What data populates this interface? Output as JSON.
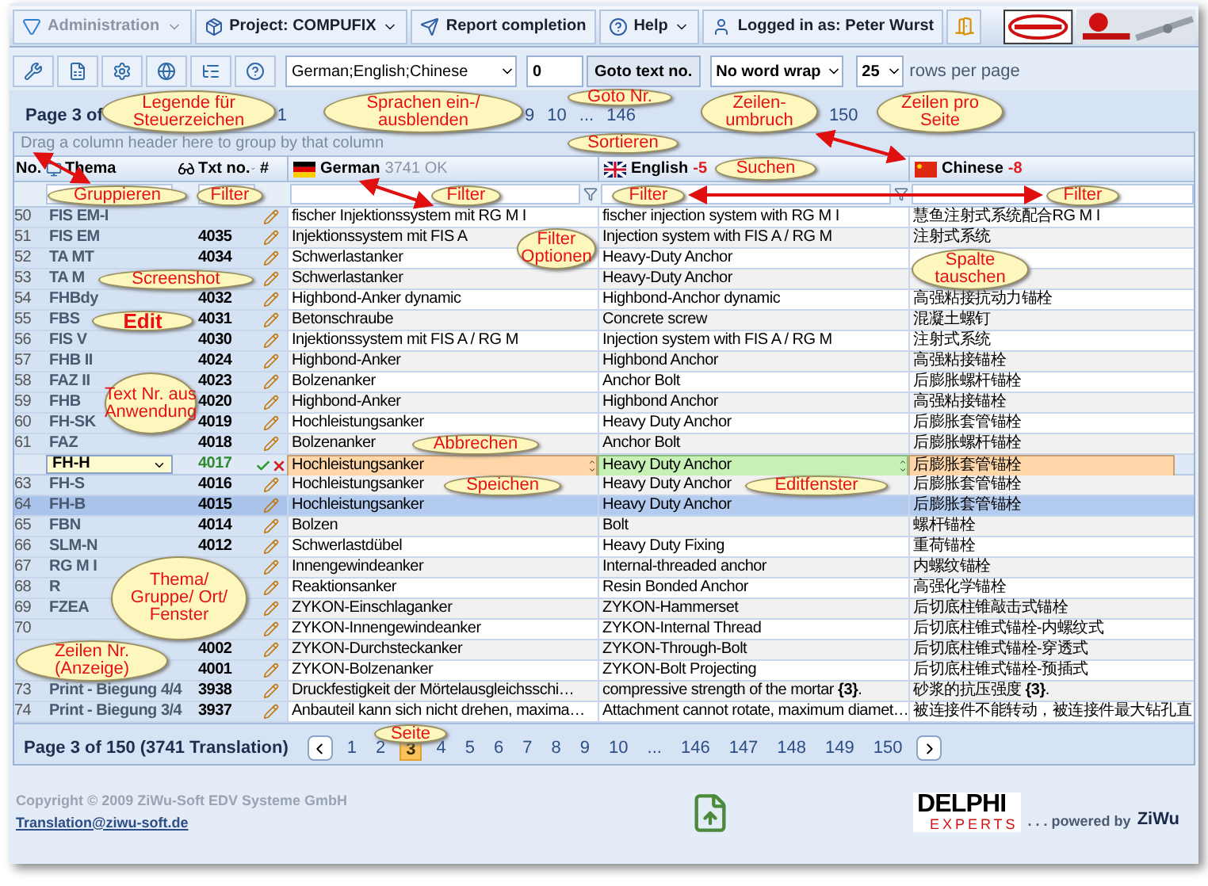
{
  "menu": [
    {
      "label": "Administration",
      "disabled": true,
      "caret": true
    },
    {
      "label": "Project: COMPUFIX",
      "disabled": false,
      "caret": true
    },
    {
      "label": "Report completion",
      "disabled": false,
      "caret": false
    },
    {
      "label": "Help",
      "disabled": false,
      "caret": true
    },
    {
      "label": "Logged in as: Peter Wurst",
      "disabled": false,
      "caret": false
    }
  ],
  "toolbar": {
    "languages": "German;English;Chinese",
    "goto_value": "0",
    "goto_button": "Goto text no.",
    "wrap": "No word wrap",
    "rows": "25",
    "rows_label": "rows per page"
  },
  "pager_top": {
    "label": "Page 3 of",
    "pages": [
      "1",
      "9",
      "10",
      "...",
      "146",
      "150"
    ]
  },
  "group_hint": "Drag a column header here to group by that column",
  "columns": {
    "no": "No.",
    "thema": "Thema",
    "txt": "Txt no.",
    "edit": "#"
  },
  "languages": [
    {
      "name": "German",
      "status": "3741 OK",
      "error": false
    },
    {
      "name": "English",
      "status": "-5",
      "error": true
    },
    {
      "name": "Chinese",
      "status": "-8",
      "error": true
    }
  ],
  "rows": [
    {
      "kind": "row",
      "selected": false,
      "no": "50",
      "thema": "FIS EM-I",
      "txt": "",
      "de": "fischer Injektionssystem mit RG M I",
      "en": "fischer injection system with RG M I",
      "zh": "慧鱼注射式系统配合RG M I"
    },
    {
      "kind": "row",
      "selected": false,
      "no": "51",
      "thema": "FIS EM",
      "txt": "4035",
      "de": "Injektionssystem mit FIS A",
      "en": "Injection system with FIS A / RG M",
      "zh": "注射式系统"
    },
    {
      "kind": "row",
      "selected": false,
      "no": "52",
      "thema": "TA MT",
      "txt": "4034",
      "de": "Schwerlastanker",
      "en": "Heavy-Duty Anchor",
      "zh": ""
    },
    {
      "kind": "row",
      "selected": false,
      "no": "53",
      "thema": "TA M",
      "txt": "",
      "de": "Schwerlastanker",
      "en": "Heavy-Duty Anchor",
      "zh": ""
    },
    {
      "kind": "row",
      "selected": false,
      "no": "54",
      "thema": "FHBdy",
      "txt": "4032",
      "de": "Highbond-Anker dynamic",
      "en": "Highbond-Anchor dynamic",
      "zh": "高强粘接抗动力锚栓"
    },
    {
      "kind": "row",
      "selected": false,
      "no": "55",
      "thema": "FBS",
      "txt": "4031",
      "de": "Betonschraube",
      "en": "Concrete screw",
      "zh": "混凝土螺钉"
    },
    {
      "kind": "row",
      "selected": false,
      "no": "56",
      "thema": "FIS V",
      "txt": "4030",
      "de": "Injektionssystem mit FIS A / RG M",
      "en": "Injection system with FIS A / RG M",
      "zh": "注射式系统"
    },
    {
      "kind": "row",
      "selected": false,
      "no": "57",
      "thema": "FHB II",
      "txt": "4024",
      "de": "Highbond-Anker",
      "en": "Highbond Anchor",
      "zh": "高强粘接锚栓"
    },
    {
      "kind": "row",
      "selected": false,
      "no": "58",
      "thema": "FAZ II",
      "txt": "4023",
      "de": "Bolzenanker",
      "en": "Anchor Bolt",
      "zh": "后膨胀螺杆锚栓"
    },
    {
      "kind": "row",
      "selected": false,
      "no": "59",
      "thema": "FHB",
      "txt": "4020",
      "de": "Highbond-Anker",
      "en": "Highbond Anchor",
      "zh": "高强粘接锚栓"
    },
    {
      "kind": "row",
      "selected": false,
      "no": "60",
      "thema": "FH-SK",
      "txt": "4019",
      "de": "Hochleistungsanker",
      "en": "Heavy Duty Anchor",
      "zh": "后膨胀套管锚栓"
    },
    {
      "kind": "row",
      "selected": false,
      "no": "61",
      "thema": "FAZ",
      "txt": "4018",
      "de": "Bolzenanker",
      "en": "Anchor Bolt",
      "zh": "后膨胀螺杆锚栓"
    },
    {
      "kind": "edit",
      "selected": false,
      "no": "",
      "thema": "FH-H",
      "txt": "4017",
      "de": "Hochleistungsanker",
      "en": "Heavy Duty Anchor",
      "zh": "后膨胀套管锚栓"
    },
    {
      "kind": "row",
      "selected": false,
      "no": "63",
      "thema": "FH-S",
      "txt": "4016",
      "de": "Hochleistungsanker",
      "en": "Heavy Duty Anchor",
      "zh": "后膨胀套管锚栓"
    },
    {
      "kind": "row",
      "selected": true,
      "no": "64",
      "thema": "FH-B",
      "txt": "4015",
      "de": "Hochleistungsanker",
      "en": "Heavy Duty Anchor",
      "zh": "后膨胀套管锚栓"
    },
    {
      "kind": "row",
      "selected": false,
      "no": "65",
      "thema": "FBN",
      "txt": "4014",
      "de": "Bolzen",
      "en": "Bolt",
      "zh": "螺杆锚栓"
    },
    {
      "kind": "row",
      "selected": false,
      "no": "66",
      "thema": "SLM-N",
      "txt": "4012",
      "de": "Schwerlastdübel",
      "en": "Heavy Duty Fixing",
      "zh": "重荷锚栓"
    },
    {
      "kind": "row",
      "selected": false,
      "no": "67",
      "thema": "RG M I",
      "txt": "",
      "de": "Innengewindeanker",
      "en": "Internal-threaded anchor",
      "zh": "内螺纹锚栓"
    },
    {
      "kind": "row",
      "selected": false,
      "no": "68",
      "thema": "R",
      "txt": "",
      "de": "Reaktionsanker",
      "en": "Resin Bonded Anchor",
      "zh": "高强化学锚栓"
    },
    {
      "kind": "row",
      "selected": false,
      "no": "69",
      "thema": "FZEA",
      "txt": "",
      "de": "ZYKON-Einschlaganker",
      "en": "ZYKON-Hammerset",
      "zh": "后切底柱锥敲击式锚栓"
    },
    {
      "kind": "row",
      "selected": false,
      "no": "70",
      "thema": "",
      "txt": "",
      "de": "ZYKON-Innengewindeanker",
      "en": "ZYKON-Internal Thread",
      "zh": "后切底柱锥式锚栓-内螺纹式"
    },
    {
      "kind": "row",
      "selected": false,
      "no": "",
      "thema": "",
      "txt": "4002",
      "de": "ZYKON-Durchsteckanker",
      "en": "ZYKON-Through-Bolt",
      "zh": "后切底柱锥式锚栓-穿透式"
    },
    {
      "kind": "row",
      "selected": false,
      "no": "",
      "thema": "",
      "txt": "4001",
      "de": "ZYKON-Bolzenanker",
      "en": "ZYKON-Bolt Projecting",
      "zh": "后切底柱锥式锚栓-预插式"
    },
    {
      "kind": "row",
      "selected": false,
      "no": "73",
      "thema": "Print - Biegung 4/4",
      "txt": "3938",
      "de": "Druckfestigkeit der Mörtelausgleichsschi…",
      "en": "compressive strength of the mortar **{3}**.",
      "zh": "砂浆的抗压强度 **{3}**."
    },
    {
      "kind": "row",
      "selected": false,
      "no": "74",
      "thema": "Print - Biegung 3/4",
      "txt": "3937",
      "de": "Anbauteil kann sich nicht drehen, maxima…",
      "en": "Attachment cannot rotate, maximum diamet…",
      "zh": "被连接件不能转动，被连接件最大钻孔直"
    }
  ],
  "pager_bottom": {
    "label": "Page 3 of 150 (3741 Translation)",
    "pages": [
      {
        "label": "1",
        "selected": false
      },
      {
        "label": "2",
        "selected": false
      },
      {
        "label": "3",
        "selected": true
      },
      {
        "label": "4",
        "selected": false
      },
      {
        "label": "5",
        "selected": false
      },
      {
        "label": "6",
        "selected": false
      },
      {
        "label": "7",
        "selected": false
      },
      {
        "label": "8",
        "selected": false
      },
      {
        "label": "9",
        "selected": false
      },
      {
        "label": "10",
        "selected": false
      },
      {
        "label": "...",
        "selected": false
      },
      {
        "label": "146",
        "selected": false
      },
      {
        "label": "147",
        "selected": false
      },
      {
        "label": "148",
        "selected": false
      },
      {
        "label": "149",
        "selected": false
      },
      {
        "label": "150",
        "selected": false
      }
    ]
  },
  "footer": {
    "copyright": "Copyright © 2009 ZiWu-Soft EDV Systeme GmbH",
    "email": "Translation@ziwu-soft.de",
    "logo_top": "DELPHI",
    "logo_bottom": "EXPERTS",
    "powered": ". . . powered by",
    "brand": "ZiWu"
  },
  "callouts": [
    {
      "text": "Legende für Steuerzeichen",
      "bold": false
    },
    {
      "text": "Sprachen ein-/ ausblenden",
      "bold": false
    },
    {
      "text": "Goto Nr.",
      "bold": false
    },
    {
      "text": "Zeilen- umbruch",
      "bold": false
    },
    {
      "text": "Zeilen pro Seite",
      "bold": false
    },
    {
      "text": "Sortieren",
      "bold": false
    },
    {
      "text": "Suchen",
      "bold": false
    },
    {
      "text": "Gruppieren",
      "bold": false
    },
    {
      "text": "Filter",
      "bold": false
    },
    {
      "text": "Filter",
      "bold": false
    },
    {
      "text": "Filter",
      "bold": false
    },
    {
      "text": "Filter",
      "bold": false
    },
    {
      "text": "Filter Optionen",
      "bold": false
    },
    {
      "text": "Screenshot",
      "bold": false
    },
    {
      "text": "Spalte tauschen",
      "bold": false
    },
    {
      "text": "Edit",
      "bold": true
    },
    {
      "text": "Text Nr. aus Anwendung",
      "bold": false
    },
    {
      "text": "Abbrechen",
      "bold": false
    },
    {
      "text": "Speichen",
      "bold": false
    },
    {
      "text": "Editfenster",
      "bold": false
    },
    {
      "text": "Thema/ Gruppe/ Ort/ Fenster",
      "bold": false
    },
    {
      "text": "Zeilen Nr. (Anzeige)",
      "bold": false
    },
    {
      "text": "Seite",
      "bold": false
    }
  ]
}
